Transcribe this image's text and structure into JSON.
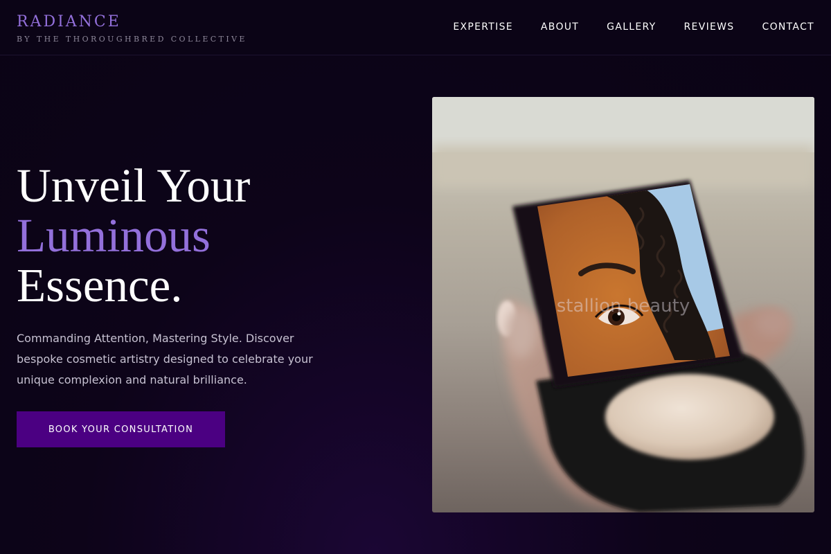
{
  "brand": {
    "name": "RADIANCE",
    "tagline": "BY THE THOROUGHBRED COLLECTIVE"
  },
  "nav": {
    "items": [
      {
        "label": "EXPERTISE"
      },
      {
        "label": "ABOUT"
      },
      {
        "label": "GALLERY"
      },
      {
        "label": "REVIEWS"
      },
      {
        "label": "CONTACT"
      }
    ]
  },
  "hero": {
    "title_line1": "Unveil Your",
    "title_accent": "Luminous",
    "title_line3": "Essence.",
    "description": "Commanding Attention, Mastering Style. Discover bespoke cosmetic artistry designed to celebrate your unique complexion and natural brilliance.",
    "cta_label": "BOOK YOUR CONSULTATION"
  },
  "image": {
    "watermark": "stallion beauty"
  },
  "colors": {
    "accent": "#9370db",
    "button": "#4b0082",
    "background": "#0c0418"
  }
}
